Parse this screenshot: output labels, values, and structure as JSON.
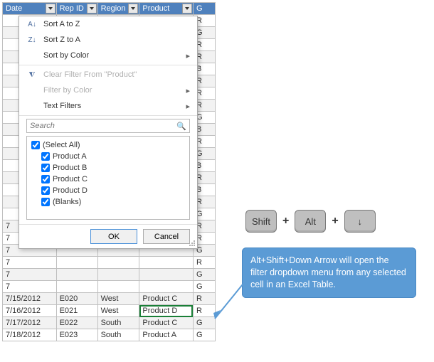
{
  "headers": {
    "date": "Date",
    "rep": "Rep ID",
    "region": "Region",
    "product": "Product",
    "last": "G"
  },
  "rows": [
    {
      "date": "",
      "rep": "",
      "region": "",
      "product": "",
      "last": "R"
    },
    {
      "date": "",
      "rep": "",
      "region": "",
      "product": "",
      "last": "G"
    },
    {
      "date": "",
      "rep": "",
      "region": "",
      "product": "",
      "last": "R"
    },
    {
      "date": "",
      "rep": "",
      "region": "",
      "product": "",
      "last": "R"
    },
    {
      "date": "",
      "rep": "",
      "region": "",
      "product": "",
      "last": "B"
    },
    {
      "date": "",
      "rep": "",
      "region": "",
      "product": "",
      "last": "R"
    },
    {
      "date": "",
      "rep": "",
      "region": "",
      "product": "",
      "last": "R"
    },
    {
      "date": "",
      "rep": "",
      "region": "",
      "product": "",
      "last": "R"
    },
    {
      "date": "",
      "rep": "",
      "region": "",
      "product": "",
      "last": "G"
    },
    {
      "date": "",
      "rep": "",
      "region": "",
      "product": "",
      "last": "B"
    },
    {
      "date": "",
      "rep": "",
      "region": "",
      "product": "",
      "last": "R"
    },
    {
      "date": "",
      "rep": "",
      "region": "",
      "product": "",
      "last": "G"
    },
    {
      "date": "",
      "rep": "",
      "region": "",
      "product": "",
      "last": "B"
    },
    {
      "date": "",
      "rep": "",
      "region": "",
      "product": "",
      "last": "R"
    },
    {
      "date": "",
      "rep": "",
      "region": "",
      "product": "",
      "last": "B"
    },
    {
      "date": "",
      "rep": "",
      "region": "",
      "product": "",
      "last": "R"
    },
    {
      "date": "",
      "rep": "",
      "region": "",
      "product": "",
      "last": "G"
    },
    {
      "date": "7",
      "rep": "",
      "region": "",
      "product": "",
      "last": "R"
    },
    {
      "date": "7",
      "rep": "",
      "region": "",
      "product": "",
      "last": "R"
    },
    {
      "date": "7",
      "rep": "",
      "region": "",
      "product": "",
      "last": "G"
    },
    {
      "date": "7",
      "rep": "",
      "region": "",
      "product": "",
      "last": "R"
    },
    {
      "date": "7",
      "rep": "",
      "region": "",
      "product": "",
      "last": "G"
    },
    {
      "date": "7",
      "rep": "",
      "region": "",
      "product": "",
      "last": "G"
    },
    {
      "date": "7/15/2012",
      "rep": "E020",
      "region": "West",
      "product": "Product C",
      "last": "R"
    },
    {
      "date": "7/16/2012",
      "rep": "E021",
      "region": "West",
      "product": "Product D",
      "last": "R",
      "selected": true
    },
    {
      "date": "7/17/2012",
      "rep": "E022",
      "region": "South",
      "product": "Product C",
      "last": "G"
    },
    {
      "date": "7/18/2012",
      "rep": "E023",
      "region": "South",
      "product": "Product A",
      "last": "G"
    }
  ],
  "dropdown": {
    "sort_az": "Sort A to Z",
    "sort_za": "Sort Z to A",
    "sort_color": "Sort by Color",
    "clear_filter": "Clear Filter From \"Product\"",
    "filter_color": "Filter by Color",
    "text_filters": "Text Filters",
    "search_placeholder": "Search",
    "checks": [
      "(Select All)",
      "Product A",
      "Product B",
      "Product C",
      "Product D",
      "(Blanks)"
    ],
    "ok": "OK",
    "cancel": "Cancel"
  },
  "keys": {
    "k1": "Shift",
    "k2": "Alt",
    "k3": "↓",
    "plus": "+"
  },
  "callout_text": "Alt+Shift+Down Arrow will open the filter dropdown menu from any selected cell in an Excel Table."
}
